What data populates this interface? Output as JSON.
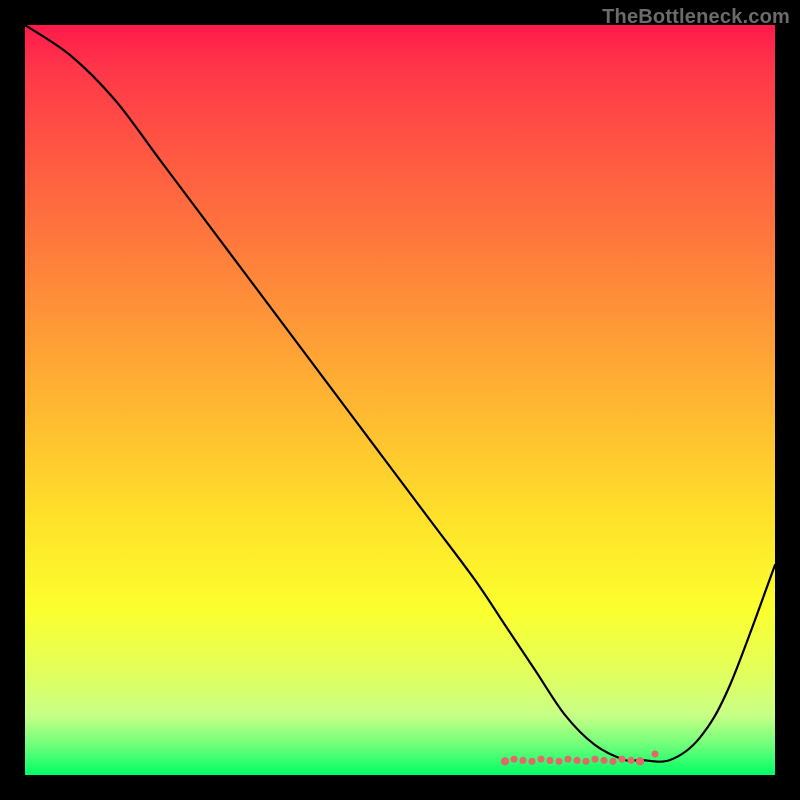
{
  "watermark": "TheBottleneck.com",
  "chart_data": {
    "type": "line",
    "title": "",
    "xlabel": "",
    "ylabel": "",
    "xlim": [
      0,
      100
    ],
    "ylim": [
      0,
      100
    ],
    "series": [
      {
        "name": "bottleneck-curve",
        "x": [
          0,
          6,
          12,
          18,
          24,
          30,
          36,
          42,
          48,
          54,
          60,
          64,
          68,
          72,
          76,
          80,
          82,
          86,
          90,
          94,
          100
        ],
        "values": [
          100,
          96,
          90,
          82,
          74,
          66,
          58,
          50,
          42,
          34,
          26,
          20,
          14,
          8,
          4,
          2,
          2,
          2,
          5,
          12,
          28
        ]
      }
    ],
    "highlight_band": {
      "x_start": 64,
      "x_end": 82,
      "y": 2
    },
    "gradient_stops": [
      {
        "pos": 0.0,
        "color": "#ff1a4b"
      },
      {
        "pos": 0.5,
        "color": "#ffc030"
      },
      {
        "pos": 0.8,
        "color": "#fbff2e"
      },
      {
        "pos": 1.0,
        "color": "#00ff66"
      }
    ]
  }
}
